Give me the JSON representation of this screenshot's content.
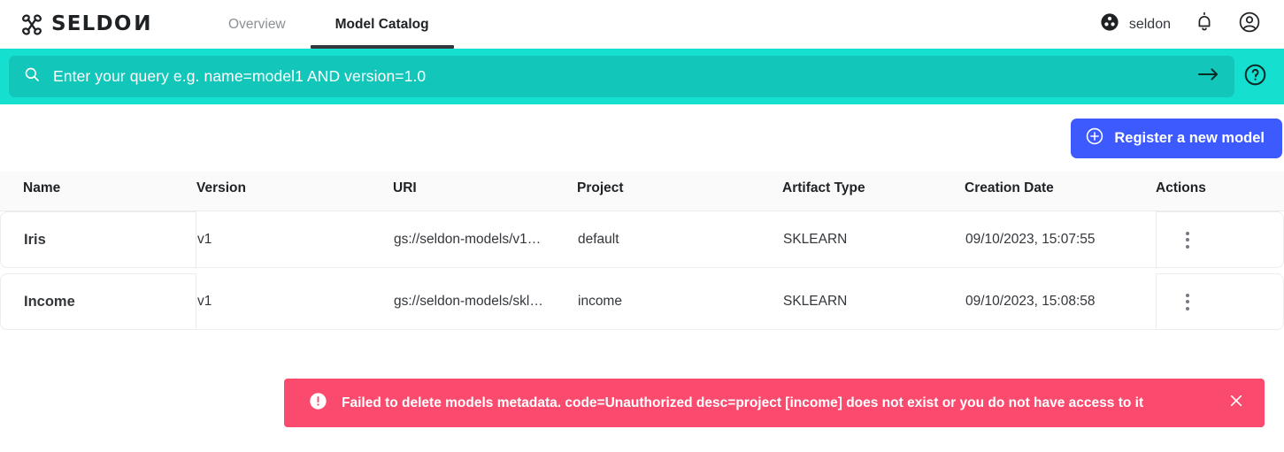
{
  "brand": {
    "name_part1": "SELDO",
    "name_part2": "N",
    "logo_icon": "seldon-knot-logo"
  },
  "nav": {
    "tabs": [
      {
        "label": "Overview",
        "active": false
      },
      {
        "label": "Model Catalog",
        "active": true
      }
    ],
    "org_name": "seldon",
    "org_icon": "org-circle-dots-icon",
    "bell_icon": "notifications-bell-icon",
    "account_icon": "account-circle-icon"
  },
  "search": {
    "placeholder": "Enter your query e.g. name=model1 AND version=1.0",
    "value": "",
    "search_icon": "search-icon",
    "submit_icon": "arrow-right-icon",
    "help_icon": "help-circle-icon"
  },
  "toolbar": {
    "register_label": "Register a new model",
    "register_icon": "plus-circle-icon",
    "register_color": "#3d5afe"
  },
  "table": {
    "columns": [
      "Name",
      "Version",
      "URI",
      "Project",
      "Artifact Type",
      "Creation Date",
      "Actions"
    ],
    "rows": [
      {
        "name": "Iris",
        "version": "v1",
        "uri": "gs://seldon-models/v1…",
        "project": "default",
        "artifact_type": "SKLEARN",
        "creation_date": "09/10/2023, 15:07:55",
        "actions_icon": "kebab-menu-icon"
      },
      {
        "name": "Income",
        "version": "v1",
        "uri": "gs://seldon-models/skl…",
        "project": "income",
        "artifact_type": "SKLEARN",
        "creation_date": "09/10/2023, 15:08:58",
        "actions_icon": "kebab-menu-icon"
      }
    ]
  },
  "toast": {
    "message": "Failed to delete models metadata. code=Unauthorized desc=project [income] does not exist or you do not have access to it",
    "icon": "error-exclamation-icon",
    "close_icon": "close-x-icon",
    "color": "#fa4a6e"
  },
  "colors": {
    "accent_teal": "#15e0d0",
    "search_field_teal": "#12c6b9",
    "primary_blue": "#3d5afe",
    "error_pink": "#fa4a6e"
  }
}
